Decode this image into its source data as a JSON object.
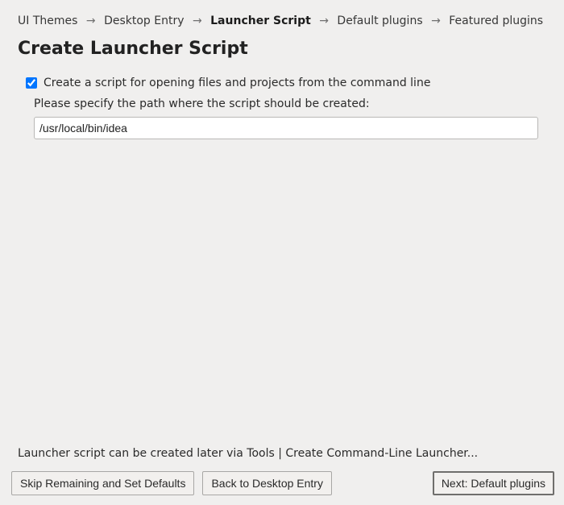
{
  "breadcrumb": {
    "items": [
      {
        "label": "UI Themes",
        "current": false
      },
      {
        "label": "Desktop Entry",
        "current": false
      },
      {
        "label": "Launcher Script",
        "current": true
      },
      {
        "label": "Default plugins",
        "current": false
      },
      {
        "label": "Featured plugins",
        "current": false
      }
    ],
    "separator": "→"
  },
  "title": "Create Launcher Script",
  "checkbox": {
    "checked": true,
    "label": "Create a script for opening files and projects from the command line"
  },
  "path_hint": "Please specify the path where the script should be created:",
  "path_value": "/usr/local/bin/idea",
  "note": "Launcher script can be created later via Tools | Create Command-Line Launcher...",
  "buttons": {
    "skip": "Skip Remaining and Set Defaults",
    "back": "Back to Desktop Entry",
    "next": "Next: Default plugins"
  }
}
